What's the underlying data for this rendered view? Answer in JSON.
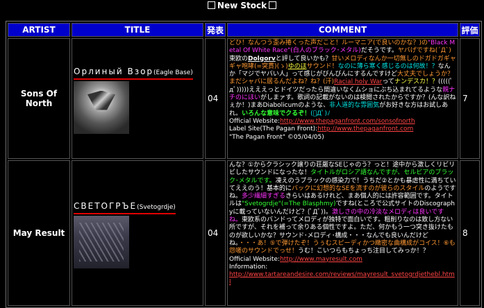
{
  "heading": {
    "text": "New Stock"
  },
  "columns": {
    "artist": "ARTIST",
    "title": "TITLE",
    "date": "発表",
    "comment": "COMMENT",
    "rating": "評価"
  },
  "rows": [
    {
      "artist": "Sons Of North",
      "title_main": "Орлиный Взор",
      "title_sub": "(Eagle Base)",
      "date": "04",
      "rating": "7",
      "comment": {
        "s1": "どひ！なんつう歪み捲くった声だこと！ルーマニア(で良いのかな？)の",
        "s2": "\"Black Metal Of White Race\"(白人のブラック･メタル)",
        "s3": "だそうです。",
        "s4": "ヤバげですね(´Д`)",
        "s5": "東欧の",
        "s6": "Dolgorv",
        "s7": "と評して良いかも？",
        "s8": "甘いメロディなんか一切無しのドガドガギャギャ咆哮(=突貫)(ゝ)",
        "s9": "ゆのほ",
        "s10": "サウンド！",
        "s11": "なのに薄ら寒く感じるのは何故！？",
        "s12": "なんか「マジでヤバい人」って感じがびんびんにするんですけど",
        "s13": "大丈夫でしょうか？まだシャバに居るんだよね？ね？(汗)",
        "s14": "Racial holy War",
        "s15": "って",
        "s16": "ナンデスカ！？",
        "s17": "(((((ﾟдﾟ)))))えええっとドイツだったら間違いなくムショにぶち込まれてるような",
        "s18": "親ナチのにほい",
        "s19": "がしまァす。歌詞の記載がないのは検閲されたからですか？(んな訳ねぇか！)まあDiabolicumのような、",
        "s20": "非人道的な雰囲気",
        "s21": "がお好きな方はお試しあれ。",
        "s22": "いろんな意味でクるぞ！",
        "s23": "(ﾟДﾟ)ﾉ",
        "website_label": "Official Website:",
        "website_url": "http://www.thepaganfront.com/sonsofnorth",
        "label_label": "Label Site(The Pagan Front):",
        "label_url": "http://www.thepaganfront.com",
        "footer": "\"The Pagan Front\" ©05/04/05)"
      }
    },
    {
      "artist": "May Result",
      "title_main": "СВЕТОГРЪЕ",
      "title_sub": "(Svetogrdje)",
      "date": "04",
      "rating": "8",
      "comment": {
        "s1": "んな？①からクラシック譲りの荘厳なSEじゃのう？っと！途中から激しくリビリビしたサウンドになったな！",
        "s2": "タイトルがロシア語なんですが、セルビアのブラック･メタルです。",
        "s3": "凍えのうブラックの感染力で！うちだ②とかも暴虐性に満ちていてええのう！基本的に",
        "s4": "バックに幻想的なSEを流すのが彼らのスタイル",
        "s5": "のようですね。",
        "s6": "多少繊細すぎる",
        "s7": "きらいはあるけれど、まあ個人的には許容範囲です。タイトルは",
        "s8": "\"Svetogrdje\"(=The Blasphmy)",
        "s9": "ですね(ところで公式サイトのDiscographyに載っていないんだけど？(ﾟДﾟ))。",
        "s10": "激しさの中の冷淡なメロディは良いですね。",
        "s11": "東欧系のバンドってメロディが独特で面白いです。粗削りなのは致し方ない所ですが、それを補って余りある個性ですよ。ただ、何かもう一つ突き抜けたものが欲しいかな？サウンド･メロディ･構成・・・なんでも良いんだけどね。",
        "s12": "・・・あ！⑤で弾けたぞ！うぅむスピーディかつ緻密な曲構成がコイス！⑥も怨嗟のサウンドでっせ！",
        "s13": "うむ！こいつらもちょっち注目してみっか！？",
        "website_label": "Official Website:",
        "website_url": "http://www.mayresult.com",
        "info_label": "Information:",
        "info_url": "http://www.tartareandesire.com/reviews/mayresult_svetogrdjethebl.html"
      }
    }
  ]
}
